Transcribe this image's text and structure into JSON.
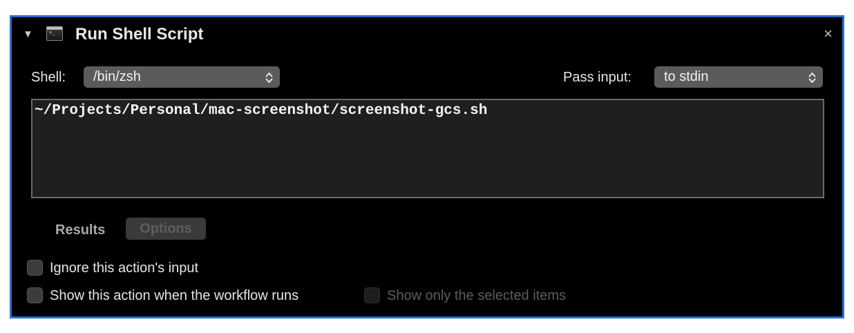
{
  "action": {
    "title": "Run Shell Script",
    "disclosure_glyph": "▼",
    "icon": "terminal-icon",
    "close_glyph": "×"
  },
  "shell": {
    "label": "Shell:",
    "value": "/bin/zsh"
  },
  "pass_input": {
    "label": "Pass input:",
    "value": "to stdin"
  },
  "chevron_glyph": "⌃⌄",
  "script": {
    "content": "~/Projects/Personal/mac-screenshot/screenshot-gcs.sh"
  },
  "tabs": {
    "results": "Results",
    "options": "Options"
  },
  "checkboxes": {
    "ignore_input": {
      "label": "Ignore this action's input",
      "checked": false
    },
    "show_when_runs": {
      "label": "Show this action when the workflow runs",
      "checked": false
    },
    "show_selected_only": {
      "label": "Show only the selected items",
      "checked": false,
      "enabled": false
    }
  },
  "colors": {
    "panel_border": "#2a6fd4",
    "panel_background": "#000000",
    "popup_background": "#5b5b5b",
    "script_background": "#1f1f1f"
  }
}
